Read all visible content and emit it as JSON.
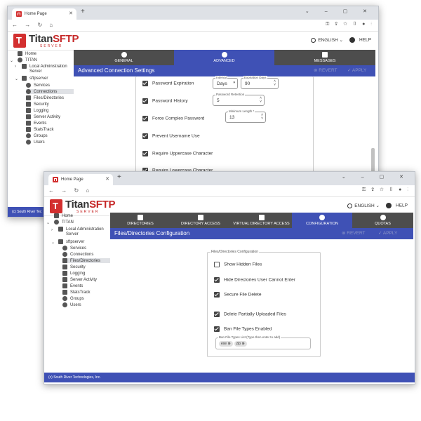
{
  "windows": [
    {
      "tab_title": "Home Page",
      "brand": {
        "name_left": "Titan",
        "name_right": "SFTP",
        "sub": "SERVER"
      },
      "lang": "ENGLISH",
      "help": "HELP",
      "tree": [
        "Home",
        "TITAN",
        "Local Administration",
        "Server",
        "sftpserver",
        "Services",
        "Connections",
        "Files/Directories",
        "Security",
        "Logging",
        "Server Activity",
        "Events",
        "StatsTrack",
        "Groups",
        "Users"
      ],
      "tabs": [
        "GENERAL",
        "ADVANCED",
        "MESSAGES"
      ],
      "header": {
        "title": "Advanced Connection Settings",
        "revert": "REVERT",
        "apply": "APPLY"
      },
      "settings": [
        {
          "label": "Password Expiration",
          "checked": true
        },
        {
          "label": "Password History",
          "checked": true
        },
        {
          "label": "Force Complex Password",
          "checked": true
        },
        {
          "label": "Prevent Username Use",
          "checked": true
        },
        {
          "label": "Require Uppercase Character",
          "checked": true
        },
        {
          "label": "Require Lowercase Character",
          "checked": true
        }
      ],
      "fields": {
        "interval": {
          "label": "Interval",
          "value": "Days"
        },
        "expiration_days": {
          "label": "Expiration Days",
          "value": "90"
        },
        "password_retention": {
          "label": "Password Retention",
          "value": "5"
        },
        "minimum_length": {
          "label": "Minimum Length *",
          "value": "13"
        }
      },
      "footer": "(c) South River Tec"
    },
    {
      "tab_title": "Home Page",
      "brand": {
        "name_left": "Titan",
        "name_right": "SFTP",
        "sub": "SERVER"
      },
      "lang": "ENGLISH",
      "help": "HELP",
      "tree": [
        "Home",
        "TITAN",
        "Local Administration",
        "Server",
        "sftpserver",
        "Services",
        "Connections",
        "Files/Directories",
        "Security",
        "Logging",
        "Server Activity",
        "Events",
        "StatsTrack",
        "Groups",
        "Users"
      ],
      "tabs": [
        "DIRECTORIES",
        "DIRECTORY ACCESS",
        "VIRTUAL DIRECTORY ACCESS",
        "CONFIGURATION",
        "QUOTAS"
      ],
      "header": {
        "title": "Files/Directories Configuration",
        "revert": "REVERT",
        "apply": "APPLY"
      },
      "box_label": "Files/Directories Configuration",
      "settings": [
        {
          "label": "Show Hidden Files",
          "checked": false
        },
        {
          "label": "Hide Directories User Cannot Enter",
          "checked": true
        },
        {
          "label": "Secure File Delete",
          "checked": true
        },
        {
          "label": "Delete Partially Uploaded Files",
          "checked": true
        },
        {
          "label": "Ban File Types Enabled",
          "checked": true
        }
      ],
      "ban_list": {
        "label": "Ban File Types List (Type then enter to add)",
        "chips": [
          "exe",
          "zip"
        ]
      },
      "footer": "(c) South River Technologies, Inc."
    }
  ],
  "colors": {
    "accent": "#3f51b5",
    "brand": "#c62828",
    "tab_dark": "#4d4d4d"
  }
}
